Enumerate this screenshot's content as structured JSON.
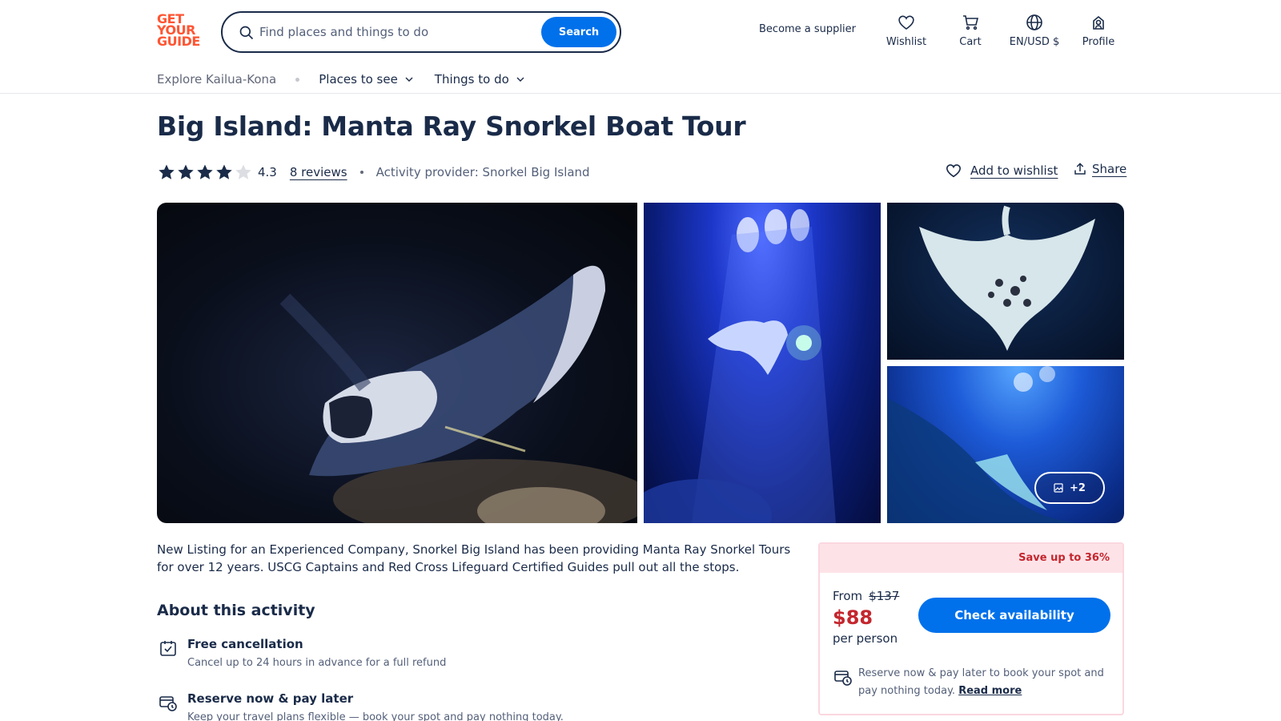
{
  "header": {
    "logo_lines": [
      "GET",
      "YOUR",
      "GUIDE"
    ],
    "search": {
      "placeholder": "Find places and things to do",
      "button_label": "Search"
    },
    "become_supplier": "Become a supplier",
    "nav": [
      {
        "label": "Wishlist",
        "icon": "heart-icon"
      },
      {
        "label": "Cart",
        "icon": "cart-icon"
      },
      {
        "label": "EN/USD $",
        "icon": "globe-icon"
      },
      {
        "label": "Profile",
        "icon": "profile-icon"
      }
    ]
  },
  "subnav": {
    "explore": "Explore Kailua-Kona",
    "items": [
      {
        "label": "Places to see"
      },
      {
        "label": "Things to do"
      }
    ]
  },
  "activity": {
    "title": "Big Island: Manta Ray Snorkel Boat Tour",
    "rating": "4.3",
    "rating_value": 4.3,
    "rating_max": 5,
    "reviews": "8 reviews",
    "provider": "Activity provider: Snorkel Big Island",
    "add_to_wishlist": "Add to wishlist",
    "share": "Share"
  },
  "gallery": {
    "more_photos": "+2"
  },
  "description": "New Listing for an Experienced Company, Snorkel Big Island has been providing Manta Ray Snorkel Tours for over 12 years. USCG Captains and Red Cross Lifeguard Certified Guides pull out all the stops.",
  "about": {
    "heading": "About this activity",
    "features": [
      {
        "title": "Free cancellation",
        "subtitle": "Cancel up to 24 hours in advance for a full refund",
        "icon": "calendar-check-icon"
      },
      {
        "title": "Reserve now & pay later",
        "subtitle": "Keep your travel plans flexible — book your spot and pay nothing today.",
        "icon": "card-clock-icon"
      }
    ]
  },
  "booking": {
    "save_badge": "Save up to 36%",
    "from_label": "From",
    "original_price": "$137",
    "price": "$88",
    "per_person": "per person",
    "check_availability": "Check availability",
    "reserve_text": "Reserve now & pay later to book your spot and pay nothing today.",
    "read_more": "Read more"
  },
  "colors": {
    "brand": "#ff5533",
    "primary_blue": "#0071eb",
    "text": "#1a2b49",
    "sale_red": "#c4262e",
    "sale_bg": "#fde3e8"
  }
}
